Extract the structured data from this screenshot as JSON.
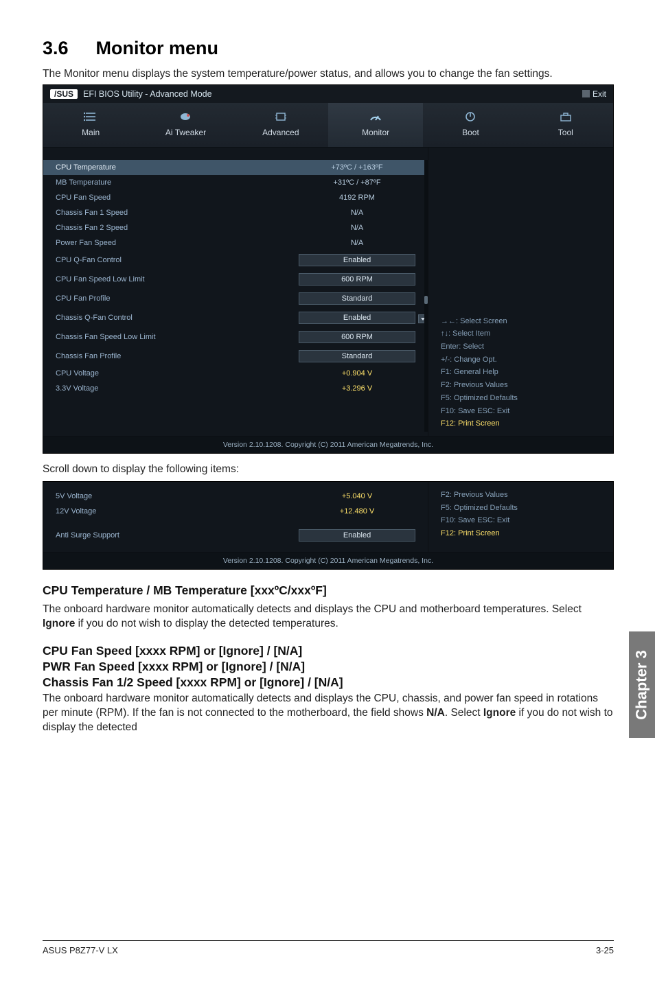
{
  "section": {
    "number": "3.6",
    "title": "Monitor menu"
  },
  "intro": "The Monitor menu displays the system temperature/power status, and allows you to change the fan settings.",
  "bios": {
    "brand": "/SUS",
    "window_title": "EFI BIOS Utility - Advanced Mode",
    "exit_label": "Exit",
    "tabs": [
      {
        "id": "main",
        "label": "Main"
      },
      {
        "id": "ai_tweaker",
        "label": "Ai Tweaker"
      },
      {
        "id": "advanced",
        "label": "Advanced"
      },
      {
        "id": "monitor",
        "label": "Monitor"
      },
      {
        "id": "boot",
        "label": "Boot"
      },
      {
        "id": "tool",
        "label": "Tool"
      }
    ],
    "active_tab": "monitor",
    "rows": [
      {
        "label": "CPU Temperature",
        "value": "+73ºC / +163ºF",
        "type": "plain",
        "highlight": true
      },
      {
        "label": "MB Temperature",
        "value": "+31ºC / +87ºF",
        "type": "plain"
      },
      {
        "label": "CPU Fan Speed",
        "value": "4192 RPM",
        "type": "plain"
      },
      {
        "label": "Chassis Fan 1 Speed",
        "value": "N/A",
        "type": "plain"
      },
      {
        "label": "Chassis Fan 2 Speed",
        "value": "N/A",
        "type": "plain"
      },
      {
        "label": "Power Fan Speed",
        "value": "N/A",
        "type": "plain"
      },
      {
        "label": "CPU Q-Fan Control",
        "value": "Enabled",
        "type": "box"
      },
      {
        "label": "CPU Fan Speed Low Limit",
        "value": "600 RPM",
        "type": "box"
      },
      {
        "label": " CPU Fan Profile",
        "value": "Standard",
        "type": "box"
      },
      {
        "label": "Chassis Q-Fan Control",
        "value": "Enabled",
        "type": "box",
        "caret": true
      },
      {
        "label": "Chassis Fan Speed Low Limit",
        "value": "600 RPM",
        "type": "box"
      },
      {
        "label": " Chassis Fan Profile",
        "value": "Standard",
        "type": "box"
      },
      {
        "label": "CPU Voltage",
        "value": "+0.904 V",
        "type": "volt"
      },
      {
        "label": "3.3V Voltage",
        "value": "+3.296 V",
        "type": "volt"
      }
    ],
    "help": {
      "l1": "→←: Select Screen",
      "l2": "↑↓: Select Item",
      "l3": "Enter: Select",
      "l4": "+/-: Change Opt.",
      "l5": "F1: General Help",
      "l6": "F2: Previous Values",
      "l7": "F5: Optimized Defaults",
      "l8": "F10: Save   ESC: Exit",
      "l9": "F12: Print Screen"
    },
    "footer": "Version 2.10.1208.  Copyright (C) 2011 American Megatrends, Inc."
  },
  "scroll_note": "Scroll down to display the following items:",
  "bios2": {
    "rows": [
      {
        "label": "5V Voltage",
        "value": "+5.040 V",
        "type": "volt"
      },
      {
        "label": "12V Voltage",
        "value": "+12.480 V",
        "type": "volt"
      },
      {
        "label": "Anti Surge Support",
        "value": "Enabled",
        "type": "box"
      }
    ],
    "help": {
      "l1": "F2: Previous Values",
      "l2": "F5: Optimized Defaults",
      "l3": "F10: Save   ESC: Exit",
      "l4": "F12: Print Screen"
    },
    "footer": "Version 2.10.1208.  Copyright (C) 2011 American Megatrends, Inc."
  },
  "subsections": {
    "s1_title": "CPU Temperature / MB Temperature [xxxºC/xxxºF]",
    "s1_body_a": "The onboard hardware monitor automatically detects and displays the CPU and motherboard temperatures. Select ",
    "s1_bold": "Ignore",
    "s1_body_b": " if you do not wish to display the detected temperatures.",
    "s2_l1": "CPU Fan Speed [xxxx RPM] or [Ignore] / [N/A]",
    "s2_l2": "PWR Fan Speed [xxxx RPM] or [Ignore] / [N/A]",
    "s2_l3": "Chassis Fan 1/2 Speed [xxxx RPM] or [Ignore] / [N/A]",
    "s2_body_a": "The onboard hardware monitor automatically detects and displays the CPU, chassis, and power fan speed in rotations per minute (RPM). If the fan is not connected to the motherboard, the field shows ",
    "s2_bold1": "N/A",
    "s2_mid": ". Select ",
    "s2_bold2": "Ignore",
    "s2_body_b": " if you do not wish to display the detected"
  },
  "chapter_tab": "Chapter 3",
  "footer": {
    "left": "ASUS P8Z77-V LX",
    "right": "3-25"
  }
}
